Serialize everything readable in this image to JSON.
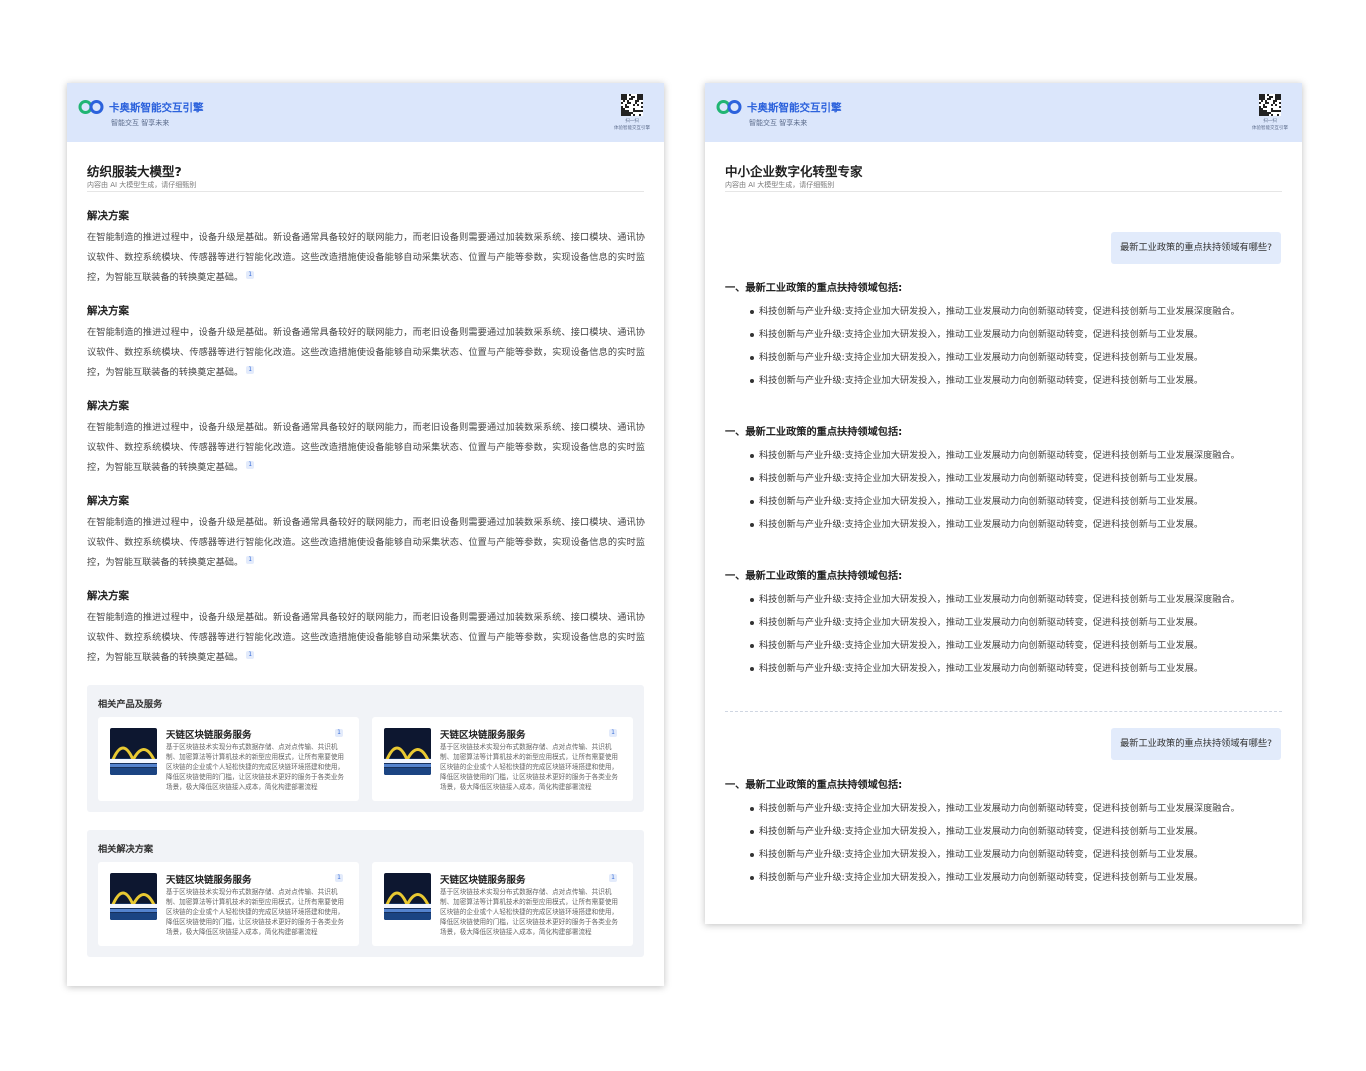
{
  "brand": {
    "name": "卡奥斯智能交互引擎",
    "slogan": "智能交互  智享未来",
    "qr_caption_1": "扫一扫",
    "qr_caption_2": "体验智能交互引擎",
    "colors": {
      "primary": "#2c62dc",
      "header_bg": "#dbe6fb",
      "logo_green": "#21b573",
      "logo_blue": "#2c62dc"
    }
  },
  "left_page": {
    "title": "纺织服装大模型?",
    "subtitle": "内容由 AI 大模型生成，请仔细甄别",
    "sections": [
      {
        "heading": "解决方案",
        "body": "在智能制造的推进过程中，设备升级是基础。新设备通常具备较好的联网能力，而老旧设备则需要通过加装数采系统、接口模块、通讯协议软件、数控系统模块、传感器等进行智能化改造。这些改造措施使设备能够自动采集状态、位置与产能等参数，实现设备信息的实时监控，为智能互联装备的转换奠定基础。",
        "cite": "1"
      },
      {
        "heading": "解决方案",
        "body": "在智能制造的推进过程中，设备升级是基础。新设备通常具备较好的联网能力，而老旧设备则需要通过加装数采系统、接口模块、通讯协议软件、数控系统模块、传感器等进行智能化改造。这些改造措施使设备能够自动采集状态、位置与产能等参数，实现设备信息的实时监控，为智能互联装备的转换奠定基础。",
        "cite": "1"
      },
      {
        "heading": "解决方案",
        "body": "在智能制造的推进过程中，设备升级是基础。新设备通常具备较好的联网能力，而老旧设备则需要通过加装数采系统、接口模块、通讯协议软件、数控系统模块、传感器等进行智能化改造。这些改造措施使设备能够自动采集状态、位置与产能等参数，实现设备信息的实时监控，为智能互联装备的转换奠定基础。",
        "cite": "1"
      },
      {
        "heading": "解决方案",
        "body": "在智能制造的推进过程中，设备升级是基础。新设备通常具备较好的联网能力，而老旧设备则需要通过加装数采系统、接口模块、通讯协议软件、数控系统模块、传感器等进行智能化改造。这些改造措施使设备能够自动采集状态、位置与产能等参数，实现设备信息的实时监控，为智能互联装备的转换奠定基础。",
        "cite": "1"
      },
      {
        "heading": "解决方案",
        "body": "在智能制造的推进过程中，设备升级是基础。新设备通常具备较好的联网能力，而老旧设备则需要通过加装数采系统、接口模块、通讯协议软件、数控系统模块、传感器等进行智能化改造。这些改造措施使设备能够自动采集状态、位置与产能等参数，实现设备信息的实时监控，为智能互联装备的转换奠定基础。",
        "cite": "1"
      }
    ],
    "related_products": {
      "heading": "相关产品及服务",
      "cards": [
        {
          "title": "天链区块链服务服务",
          "badge": "1",
          "desc": "基于区块链技术实现分布式数据存储、点对点传输、共识机制、加密算法等计算机技术的新型应用模式，让所有需要使用区块链的企业或个人轻松快捷的完成区块链环境搭建和使用，降低区块链使用的门槛，让区块链技术更好的服务于各类业务场景，极大降低区块链接入成本，简化构建部署流程"
        },
        {
          "title": "天链区块链服务服务",
          "badge": "1",
          "desc": "基于区块链技术实现分布式数据存储、点对点传输、共识机制、加密算法等计算机技术的新型应用模式，让所有需要使用区块链的企业或个人轻松快捷的完成区块链环境搭建和使用，降低区块链使用的门槛，让区块链技术更好的服务于各类业务场景，极大降低区块链接入成本，简化构建部署流程"
        }
      ]
    },
    "related_solutions": {
      "heading": "相关解决方案",
      "cards": [
        {
          "title": "天链区块链服务服务",
          "badge": "1",
          "desc": "基于区块链技术实现分布式数据存储、点对点传输、共识机制、加密算法等计算机技术的新型应用模式，让所有需要使用区块链的企业或个人轻松快捷的完成区块链环境搭建和使用，降低区块链使用的门槛，让区块链技术更好的服务于各类业务场景，极大降低区块链接入成本，简化构建部署流程"
        },
        {
          "title": "天链区块链服务服务",
          "badge": "1",
          "desc": "基于区块链技术实现分布式数据存储、点对点传输、共识机制、加密算法等计算机技术的新型应用模式，让所有需要使用区块链的企业或个人轻松快捷的完成区块链环境搭建和使用，降低区块链使用的门槛，让区块链技术更好的服务于各类业务场景，极大降低区块链接入成本，简化构建部署流程"
        }
      ]
    }
  },
  "right_page": {
    "title": "中小企业数字化转型专家",
    "subtitle": "内容由 AI 大模型生成，请仔细甄别",
    "question": "最新工业政策的重点扶持领域有哪些?",
    "answer_heading": "一、最新工业政策的重点扶持领域包括:",
    "item_head": "科技创新与产业升级:",
    "item_body_long": "支持企业加大研发投入，推动工业发展动力向创新驱动转变，促进科技创新与工业发展深度融合。",
    "item_body_short": "支持企业加大研发投入，推动工业发展动力向创新驱动转变，促进科技创新与工业发展。"
  }
}
